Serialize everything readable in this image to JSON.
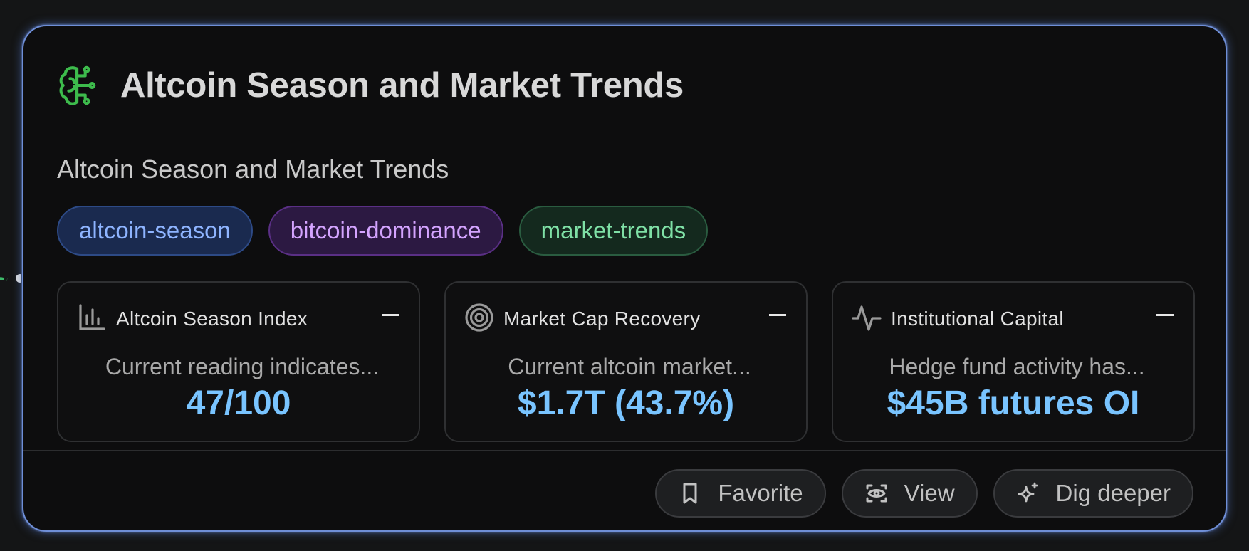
{
  "card": {
    "title": "Altcoin Season and Market Trends",
    "subtitle": "Altcoin Season and Market Trends",
    "title_icon": "brain-circuit-icon",
    "accent_color": "#3dbb4c",
    "border_color": "#6f8fd8"
  },
  "tags": [
    {
      "label": "altcoin-season",
      "color": "#8eb4ff"
    },
    {
      "label": "bitcoin-dominance",
      "color": "#d4a4ff"
    },
    {
      "label": "market-trends",
      "color": "#7fe0a6"
    }
  ],
  "metrics": [
    {
      "label": "Altcoin Season Index",
      "icon": "bar-chart-icon",
      "description": "Current reading indicates...",
      "value": "47/100"
    },
    {
      "label": "Market Cap Recovery",
      "icon": "target-icon",
      "description": "Current altcoin market...",
      "value": "$1.7T (43.7%)"
    },
    {
      "label": "Institutional Capital",
      "icon": "activity-icon",
      "description": "Hedge fund activity has...",
      "value": "$45B futures OI"
    }
  ],
  "actions": [
    {
      "label": "Favorite",
      "icon": "bookmark-icon"
    },
    {
      "label": "View",
      "icon": "view-icon"
    },
    {
      "label": "Dig deeper",
      "icon": "sparkles-icon"
    }
  ],
  "value_color": "#79c4ff"
}
